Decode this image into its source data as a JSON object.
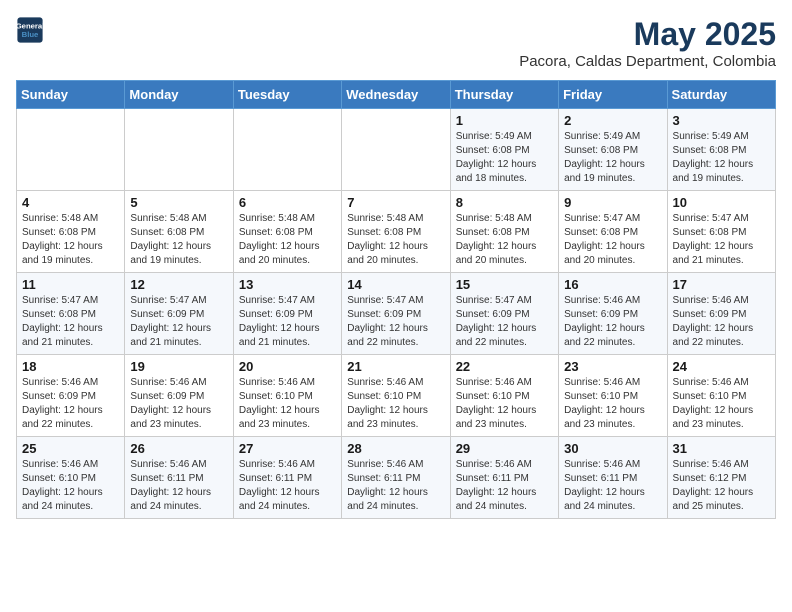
{
  "logo": {
    "line1": "General",
    "line2": "Blue"
  },
  "title": {
    "month_year": "May 2025",
    "location": "Pacora, Caldas Department, Colombia"
  },
  "days_of_week": [
    "Sunday",
    "Monday",
    "Tuesday",
    "Wednesday",
    "Thursday",
    "Friday",
    "Saturday"
  ],
  "weeks": [
    [
      {
        "day": "",
        "info": ""
      },
      {
        "day": "",
        "info": ""
      },
      {
        "day": "",
        "info": ""
      },
      {
        "day": "",
        "info": ""
      },
      {
        "day": "1",
        "info": "Sunrise: 5:49 AM\nSunset: 6:08 PM\nDaylight: 12 hours\nand 18 minutes."
      },
      {
        "day": "2",
        "info": "Sunrise: 5:49 AM\nSunset: 6:08 PM\nDaylight: 12 hours\nand 19 minutes."
      },
      {
        "day": "3",
        "info": "Sunrise: 5:49 AM\nSunset: 6:08 PM\nDaylight: 12 hours\nand 19 minutes."
      }
    ],
    [
      {
        "day": "4",
        "info": "Sunrise: 5:48 AM\nSunset: 6:08 PM\nDaylight: 12 hours\nand 19 minutes."
      },
      {
        "day": "5",
        "info": "Sunrise: 5:48 AM\nSunset: 6:08 PM\nDaylight: 12 hours\nand 19 minutes."
      },
      {
        "day": "6",
        "info": "Sunrise: 5:48 AM\nSunset: 6:08 PM\nDaylight: 12 hours\nand 20 minutes."
      },
      {
        "day": "7",
        "info": "Sunrise: 5:48 AM\nSunset: 6:08 PM\nDaylight: 12 hours\nand 20 minutes."
      },
      {
        "day": "8",
        "info": "Sunrise: 5:48 AM\nSunset: 6:08 PM\nDaylight: 12 hours\nand 20 minutes."
      },
      {
        "day": "9",
        "info": "Sunrise: 5:47 AM\nSunset: 6:08 PM\nDaylight: 12 hours\nand 20 minutes."
      },
      {
        "day": "10",
        "info": "Sunrise: 5:47 AM\nSunset: 6:08 PM\nDaylight: 12 hours\nand 21 minutes."
      }
    ],
    [
      {
        "day": "11",
        "info": "Sunrise: 5:47 AM\nSunset: 6:08 PM\nDaylight: 12 hours\nand 21 minutes."
      },
      {
        "day": "12",
        "info": "Sunrise: 5:47 AM\nSunset: 6:09 PM\nDaylight: 12 hours\nand 21 minutes."
      },
      {
        "day": "13",
        "info": "Sunrise: 5:47 AM\nSunset: 6:09 PM\nDaylight: 12 hours\nand 21 minutes."
      },
      {
        "day": "14",
        "info": "Sunrise: 5:47 AM\nSunset: 6:09 PM\nDaylight: 12 hours\nand 22 minutes."
      },
      {
        "day": "15",
        "info": "Sunrise: 5:47 AM\nSunset: 6:09 PM\nDaylight: 12 hours\nand 22 minutes."
      },
      {
        "day": "16",
        "info": "Sunrise: 5:46 AM\nSunset: 6:09 PM\nDaylight: 12 hours\nand 22 minutes."
      },
      {
        "day": "17",
        "info": "Sunrise: 5:46 AM\nSunset: 6:09 PM\nDaylight: 12 hours\nand 22 minutes."
      }
    ],
    [
      {
        "day": "18",
        "info": "Sunrise: 5:46 AM\nSunset: 6:09 PM\nDaylight: 12 hours\nand 22 minutes."
      },
      {
        "day": "19",
        "info": "Sunrise: 5:46 AM\nSunset: 6:09 PM\nDaylight: 12 hours\nand 23 minutes."
      },
      {
        "day": "20",
        "info": "Sunrise: 5:46 AM\nSunset: 6:10 PM\nDaylight: 12 hours\nand 23 minutes."
      },
      {
        "day": "21",
        "info": "Sunrise: 5:46 AM\nSunset: 6:10 PM\nDaylight: 12 hours\nand 23 minutes."
      },
      {
        "day": "22",
        "info": "Sunrise: 5:46 AM\nSunset: 6:10 PM\nDaylight: 12 hours\nand 23 minutes."
      },
      {
        "day": "23",
        "info": "Sunrise: 5:46 AM\nSunset: 6:10 PM\nDaylight: 12 hours\nand 23 minutes."
      },
      {
        "day": "24",
        "info": "Sunrise: 5:46 AM\nSunset: 6:10 PM\nDaylight: 12 hours\nand 23 minutes."
      }
    ],
    [
      {
        "day": "25",
        "info": "Sunrise: 5:46 AM\nSunset: 6:10 PM\nDaylight: 12 hours\nand 24 minutes."
      },
      {
        "day": "26",
        "info": "Sunrise: 5:46 AM\nSunset: 6:11 PM\nDaylight: 12 hours\nand 24 minutes."
      },
      {
        "day": "27",
        "info": "Sunrise: 5:46 AM\nSunset: 6:11 PM\nDaylight: 12 hours\nand 24 minutes."
      },
      {
        "day": "28",
        "info": "Sunrise: 5:46 AM\nSunset: 6:11 PM\nDaylight: 12 hours\nand 24 minutes."
      },
      {
        "day": "29",
        "info": "Sunrise: 5:46 AM\nSunset: 6:11 PM\nDaylight: 12 hours\nand 24 minutes."
      },
      {
        "day": "30",
        "info": "Sunrise: 5:46 AM\nSunset: 6:11 PM\nDaylight: 12 hours\nand 24 minutes."
      },
      {
        "day": "31",
        "info": "Sunrise: 5:46 AM\nSunset: 6:12 PM\nDaylight: 12 hours\nand 25 minutes."
      }
    ]
  ]
}
